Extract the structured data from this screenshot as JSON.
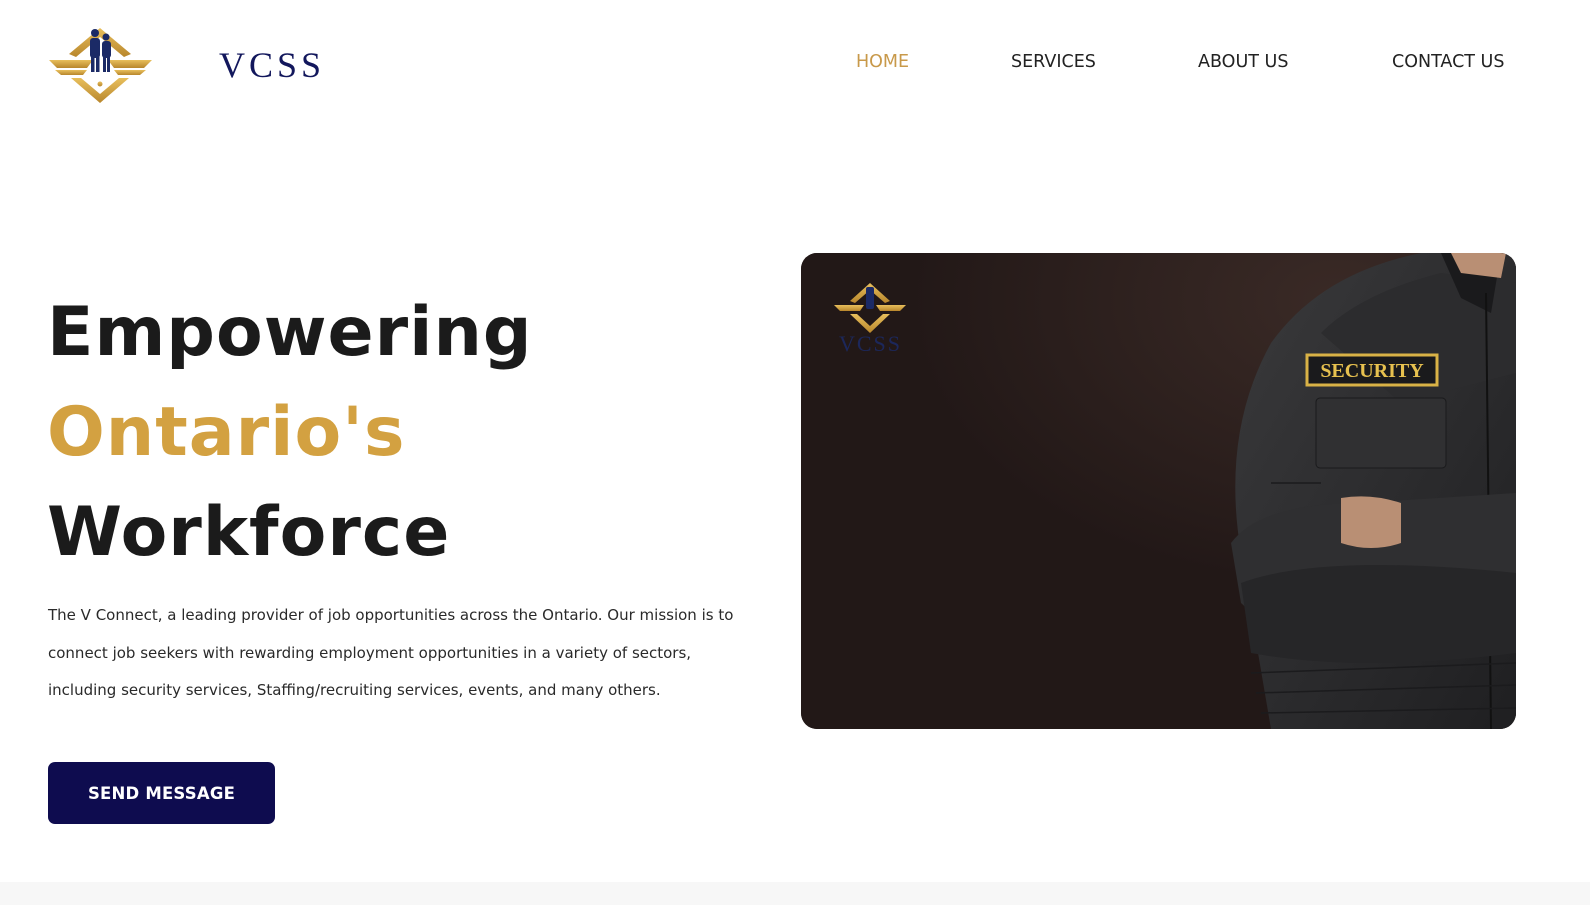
{
  "brand": {
    "name": "VCSS",
    "logo_icon": "vcss-logo-icon"
  },
  "nav": {
    "items": [
      {
        "label": "HOME",
        "active": true
      },
      {
        "label": "SERVICES",
        "active": false
      },
      {
        "label": "ABOUT US",
        "active": false
      },
      {
        "label": "CONTACT US",
        "active": false
      }
    ]
  },
  "hero": {
    "title_line1": "Empowering",
    "title_line2": "Ontario's",
    "title_line3": "Workforce",
    "description_line1": "The V Connect, a leading provider of job opportunities across the Ontario. Our mission is to",
    "description_line2": "connect job seekers with rewarding employment opportunities in a variety of sectors,",
    "description_line3": "including security services, Staffing/recruiting services, events, and many others.",
    "cta_label": "SEND MESSAGE"
  },
  "hero_image": {
    "watermark_text": "VCSS",
    "patch_text": "SECURITY"
  },
  "colors": {
    "accent_gold": "#d3a141",
    "nav_active": "#c8994a",
    "brand_navy": "#12175c",
    "button_bg": "#0e0c4f",
    "image_bg": "#221817"
  }
}
